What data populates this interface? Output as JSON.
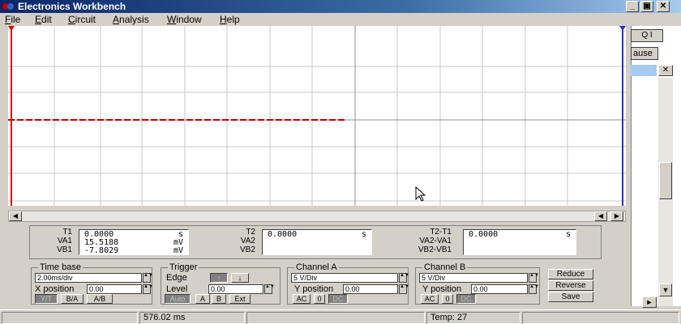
{
  "window": {
    "title": "Electronics Workbench"
  },
  "menu": [
    {
      "label": "File",
      "ul": "F",
      "rest": "ile"
    },
    {
      "label": "Edit",
      "ul": "E",
      "rest": "dit"
    },
    {
      "label": "Circuit",
      "ul": "C",
      "rest": "ircuit"
    },
    {
      "label": "Analysis",
      "ul": "A",
      "rest": "nalysis"
    },
    {
      "label": "Window",
      "ul": "W",
      "rest": "indow"
    },
    {
      "label": "Help",
      "ul": "H",
      "rest": "elp"
    }
  ],
  "background_panel": {
    "pause_label": "ause",
    "zoom_label": "Q I"
  },
  "readouts": {
    "t1": {
      "label": "T1",
      "value": "0.0000",
      "unit": "s"
    },
    "va1": {
      "label": "VA1",
      "value": "15.5188",
      "unit": "mV"
    },
    "vb1": {
      "label": "VB1",
      "value": "-7.8029",
      "unit": "mV"
    },
    "t2": {
      "label": "T2",
      "value": "0.0000",
      "unit": "s"
    },
    "va2": {
      "label": "VA2"
    },
    "vb2": {
      "label": "VB2"
    },
    "t2_t1": {
      "label": "T2-T1",
      "value": "0.0000",
      "unit": "s"
    },
    "va2_va1": {
      "label": "VA2-VA1"
    },
    "vb2_vb1": {
      "label": "VB2-VB1"
    }
  },
  "timebase": {
    "title": "Time base",
    "value": "2.00ms/div",
    "xpos_label": "X position",
    "xpos_value": "0.00",
    "modes": [
      "Y/T",
      "B/A",
      "A/B"
    ]
  },
  "trigger": {
    "title": "Trigger",
    "edge_label": "Edge",
    "level_label": "Level",
    "level_value": "0.00",
    "sources": [
      "Auto",
      "A",
      "B",
      "Ext"
    ]
  },
  "channel_a": {
    "title": "Channel A",
    "scale": "5 V/Div",
    "ypos_label": "Y position",
    "ypos_value": "0.00",
    "coupling": [
      "AC",
      "0",
      "DC"
    ]
  },
  "channel_b": {
    "title": "Channel B",
    "scale": "5 V/Div",
    "ypos_label": "Y position",
    "ypos_value": "0.00",
    "coupling": [
      "AC",
      "0",
      "DC"
    ]
  },
  "buttons": {
    "reduce": "Reduce",
    "reverse": "Reverse",
    "save": "Save"
  },
  "status": {
    "time": "576.02 ms",
    "temp": "Temp:  27"
  },
  "colors": {
    "trace": "#c00000",
    "cursor1": "#e00000",
    "cursor2": "#3030c0",
    "grid": "#c0c0c0"
  }
}
